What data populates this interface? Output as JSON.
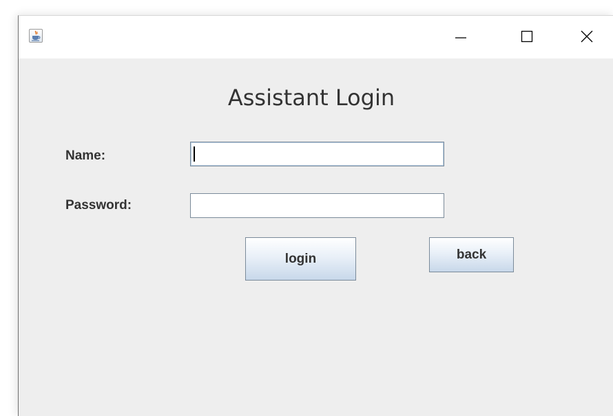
{
  "window": {
    "title": "",
    "icon": "java-cup-icon",
    "controls": {
      "minimize_icon": "minimize-icon",
      "maximize_icon": "maximize-icon",
      "close_icon": "close-icon"
    }
  },
  "form": {
    "heading": "Assistant Login",
    "name_label": "Name:",
    "name_value": "",
    "password_label": "Password:",
    "password_value": "",
    "login_label": "login",
    "back_label": "back"
  },
  "colors": {
    "window_background": "#eeeeee",
    "titlebar_background": "#ffffff",
    "text": "#333333",
    "field_border": "#7a8a99",
    "button_gradient_top": "#ffffff",
    "button_gradient_bottom": "#c8d8ea"
  }
}
